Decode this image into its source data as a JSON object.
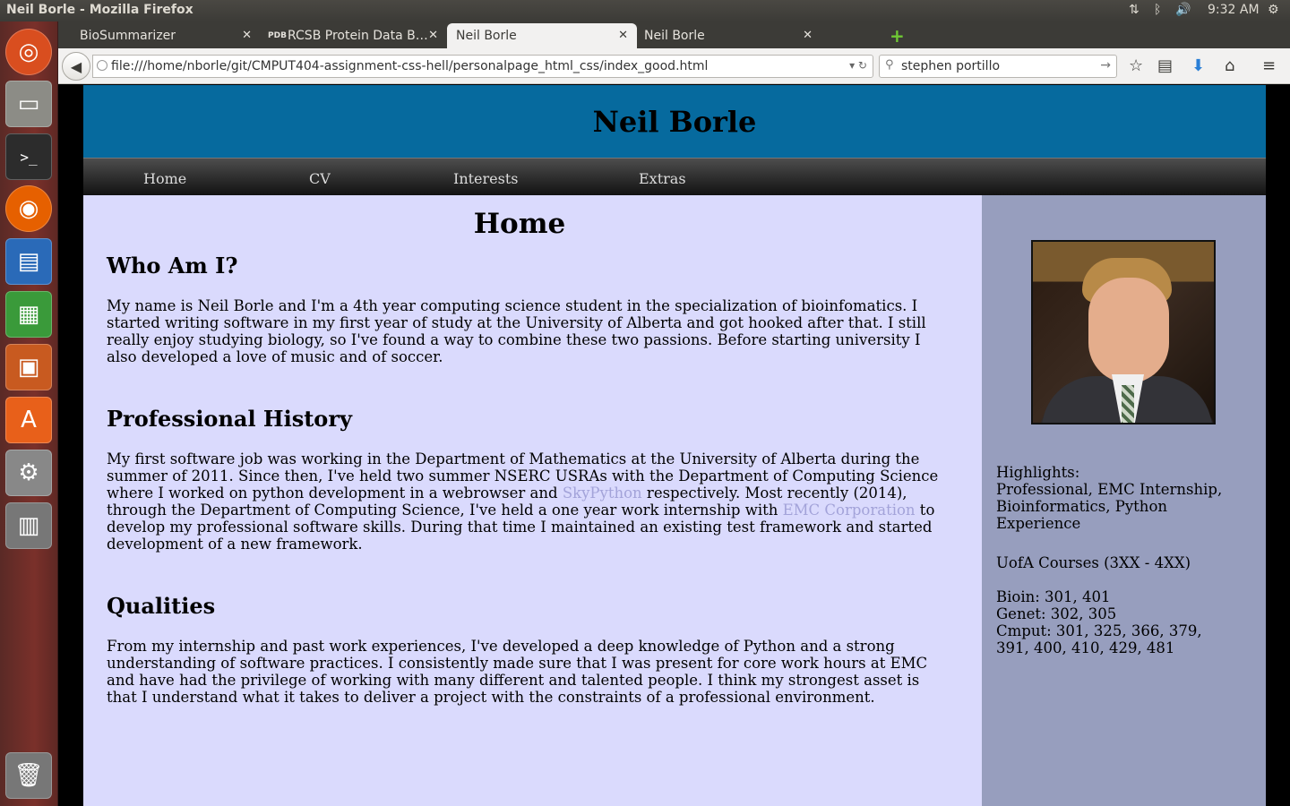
{
  "os": {
    "window_title": "Neil Borle - Mozilla Firefox",
    "clock": "9:32 AM"
  },
  "browser": {
    "tabs": [
      {
        "label": "BioSummarizer",
        "close": "✕"
      },
      {
        "label": "RCSB Protein Data B…",
        "favicon": "PDB",
        "close": "✕"
      },
      {
        "label": "Neil Borle",
        "close": "✕",
        "active": true
      },
      {
        "label": "Neil Borle",
        "close": "✕"
      }
    ],
    "url": "file:///home/nborle/git/CMPUT404-assignment-css-hell/personalpage_html_css/index_good.html",
    "search_value": "stephen portillo"
  },
  "site": {
    "header_title": "Neil Borle",
    "nav": [
      "Home",
      "CV",
      "Interests",
      "Extras"
    ],
    "page_heading": "Home",
    "sections": {
      "who": {
        "heading": "Who Am I?",
        "text": "My name is Neil Borle and I'm a 4th year computing science student in the specialization of bioinfomatics. I started writing software in my first year of study at the University of Alberta and got hooked after that. I still really enjoy studying biology, so I've found a way to combine these two passions. Before starting university I also developed a love of music and of soccer."
      },
      "history": {
        "heading": "Professional History",
        "text_1": "My first software job was working in the Department of Mathematics at the University of Alberta during the summer of 2011. Since then, I've held two summer NSERC USRAs with the Department of Computing Science where I worked on python development in a webrowser and ",
        "link_1": "SkyPython",
        "text_2": " respectively. Most recently (2014), through the Department of Computing Science, I've held a one year work internship with ",
        "link_2": "EMC Corporation",
        "text_3": " to develop my professional software skills. During that time I maintained an existing test framework and started development of a new framework."
      },
      "qualities": {
        "heading": "Qualities",
        "text": "From my internship and past work experiences, I've developed a deep knowledge of Python and a strong understanding of software practices. I consistently made sure that I was present for core work hours at EMC and have had the privilege of working with many different and talented people. I think my strongest asset is that I understand what it takes to deliver a project with the constraints of a professional environment."
      }
    },
    "sidebar": {
      "highlights_label": "Highlights:",
      "highlights_text": "Professional, EMC Internship, Bioinformatics, Python Experience",
      "courses_label": "UofA Courses (3XX - 4XX)",
      "bioin": "Bioin: 301, 401",
      "genet": "Genet: 302, 305",
      "cmput": "Cmput: 301, 325, 366, 379, 391, 400, 410, 429, 481"
    }
  },
  "colors": {
    "header_bg": "#066a9e",
    "main_bg": "#dadafd",
    "sidebar_bg": "#979ebe",
    "link": "#a3a3d9"
  }
}
